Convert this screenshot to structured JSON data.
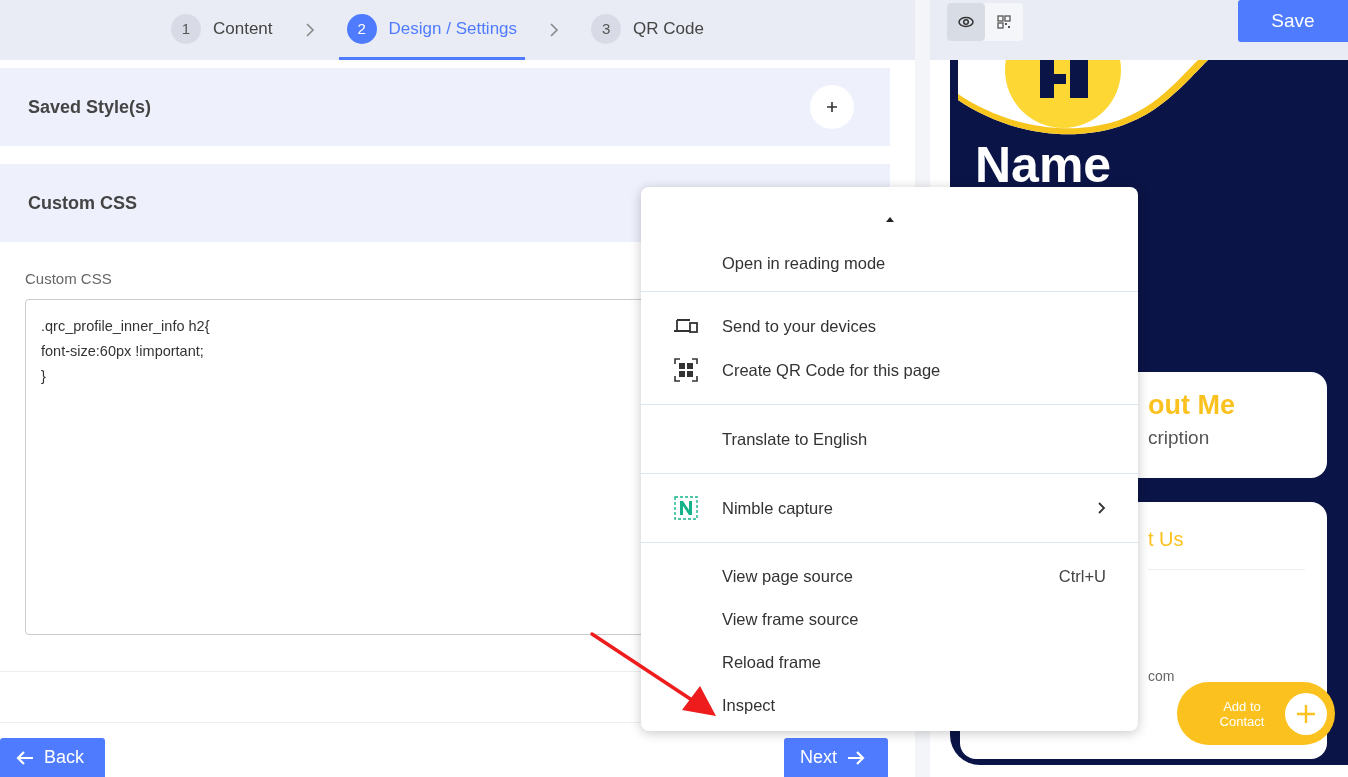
{
  "steps": [
    {
      "number": "1",
      "label": "Content",
      "selected": false
    },
    {
      "number": "2",
      "label": "Design / Settings",
      "selected": true
    },
    {
      "number": "3",
      "label": "QR Code",
      "selected": false
    }
  ],
  "toolbar": {
    "preview_modes": [
      {
        "kind": "eye",
        "selected": true
      },
      {
        "kind": "qr",
        "selected": false
      }
    ],
    "save": "Save"
  },
  "sections": [
    {
      "title": "Saved Style(s)",
      "expanded": false
    },
    {
      "title": "Custom CSS",
      "expanded": true,
      "field_label": "Custom CSS",
      "value": ".qrc_profile_inner_info h2{\nfont-size:60px !important;\n}"
    }
  ],
  "nav": {
    "back": "Back",
    "next": "Next"
  },
  "preview": {
    "name": "Name",
    "cards": [
      {
        "kind": "about",
        "title": "out Me",
        "text": "cription"
      },
      {
        "kind": "contact",
        "title": "t Us",
        "text": "com"
      }
    ],
    "add_contact": "Add to Contact"
  },
  "context_menu": {
    "groups": [
      [
        {
          "kind": "plain",
          "label": "Open in reading mode"
        }
      ],
      [
        {
          "kind": "devices",
          "label": "Send to your devices"
        },
        {
          "kind": "qr",
          "label": "Create QR Code for this page"
        }
      ],
      [
        {
          "kind": "plain",
          "label": "Translate to English"
        }
      ],
      [
        {
          "kind": "nimble",
          "label": "Nimble capture",
          "submenu": true
        }
      ],
      [
        {
          "kind": "plain",
          "label": "View page source",
          "shortcut": "Ctrl+U"
        },
        {
          "kind": "plain",
          "label": "View frame source"
        },
        {
          "kind": "plain",
          "label": "Reload frame"
        },
        {
          "kind": "plain",
          "label": "Inspect"
        }
      ]
    ]
  }
}
